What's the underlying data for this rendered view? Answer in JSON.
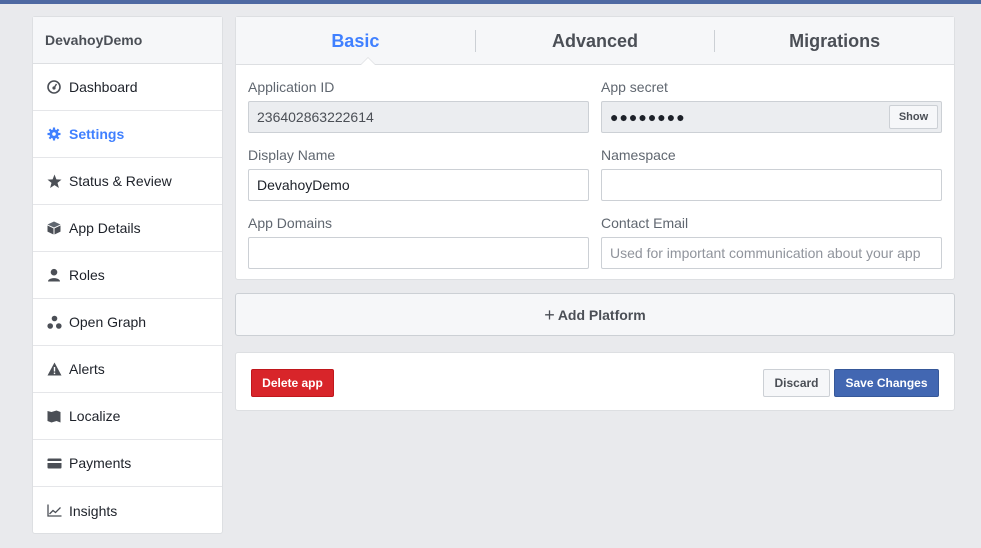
{
  "sidebar": {
    "title": "DevahoyDemo",
    "items": [
      {
        "label": "Dashboard",
        "icon": "dashboard-icon"
      },
      {
        "label": "Settings",
        "icon": "gear-icon",
        "active": true
      },
      {
        "label": "Status & Review",
        "icon": "star-icon"
      },
      {
        "label": "App Details",
        "icon": "cube-icon"
      },
      {
        "label": "Roles",
        "icon": "person-icon"
      },
      {
        "label": "Open Graph",
        "icon": "graph-nodes-icon"
      },
      {
        "label": "Alerts",
        "icon": "warning-icon"
      },
      {
        "label": "Localize",
        "icon": "map-icon"
      },
      {
        "label": "Payments",
        "icon": "credit-card-icon"
      },
      {
        "label": "Insights",
        "icon": "line-chart-icon"
      }
    ]
  },
  "tabs": [
    {
      "label": "Basic",
      "active": true
    },
    {
      "label": "Advanced"
    },
    {
      "label": "Migrations"
    }
  ],
  "form": {
    "application_id": {
      "label": "Application ID",
      "value": "236402863222614"
    },
    "app_secret": {
      "label": "App secret",
      "value": "●●●●●●●●",
      "show_label": "Show"
    },
    "display_name": {
      "label": "Display Name",
      "value": "DevahoyDemo"
    },
    "namespace": {
      "label": "Namespace",
      "value": ""
    },
    "app_domains": {
      "label": "App Domains",
      "value": ""
    },
    "contact_email": {
      "label": "Contact Email",
      "placeholder": "Used for important communication about your app"
    }
  },
  "add_platform": {
    "plus": "+",
    "label": "Add Platform"
  },
  "actions": {
    "delete_label": "Delete app",
    "discard_label": "Discard",
    "save_label": "Save Changes"
  },
  "colors": {
    "accent": "#4080ff",
    "brand": "#4267b2",
    "danger": "#d8252a",
    "background": "#e9eaed"
  }
}
